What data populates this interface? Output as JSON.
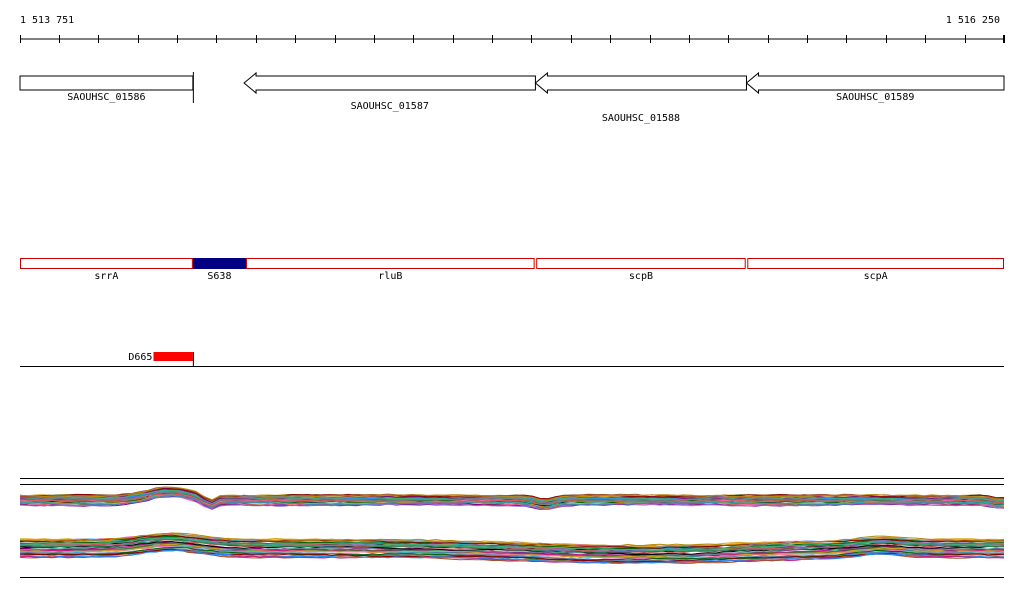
{
  "ruler": {
    "start_label": "1 513 751",
    "end_label": "1 516 250",
    "start": 1513751,
    "end": 1516250
  },
  "genes_top": [
    {
      "name": "SAOUHSC_01586",
      "start": 1513751,
      "end": 1514190,
      "strand": "+"
    },
    {
      "name": "SAOUHSC_01587",
      "start": 1514320,
      "end": 1515060,
      "strand": "-"
    },
    {
      "name": "SAOUHSC_01588",
      "start": 1515060,
      "end": 1515596,
      "strand": "-"
    },
    {
      "name": "SAOUHSC_01589",
      "start": 1515596,
      "end": 1516250,
      "strand": "-"
    }
  ],
  "features_mid": [
    {
      "name": "srrA",
      "start": 1513751,
      "end": 1514190,
      "fill": "none"
    },
    {
      "name": "S638",
      "start": 1514190,
      "end": 1514325,
      "fill": "#000080"
    },
    {
      "name": "rluB",
      "start": 1514325,
      "end": 1515058,
      "fill": "none"
    },
    {
      "name": "scpB",
      "start": 1515062,
      "end": 1515594,
      "fill": "none"
    },
    {
      "name": "scpA",
      "start": 1515598,
      "end": 1516250,
      "fill": "none"
    }
  ],
  "features_low": [
    {
      "name": "D665",
      "start": 1514090,
      "end": 1514190,
      "color": "#ff0000"
    }
  ],
  "colors": {
    "gene_outline": "#000000",
    "feature_outline": "#cc0000",
    "srna_fill": "#000080",
    "antisense_fill": "#ff0000"
  }
}
